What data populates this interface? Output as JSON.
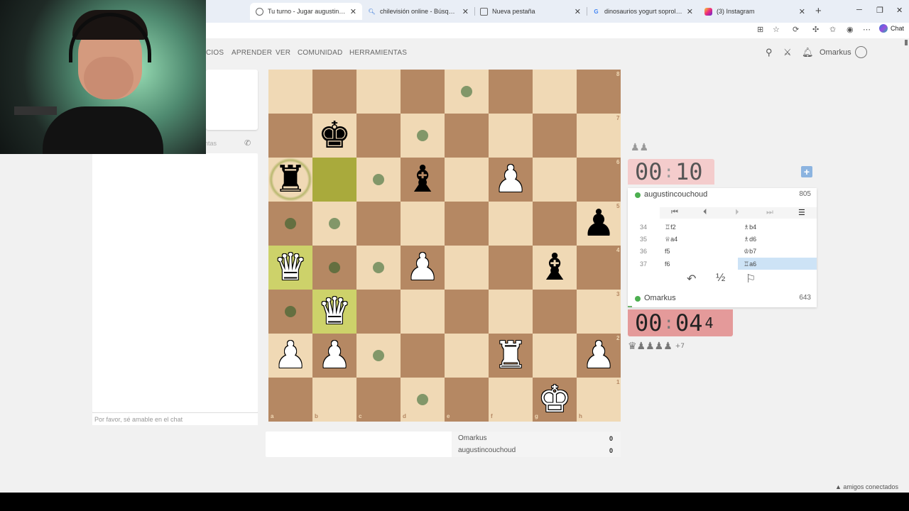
{
  "browser": {
    "tabs": [
      {
        "title": "Tu turno - Jugar augustincouchoud",
        "active": true
      },
      {
        "title": "chilevisión online - Búsqueda",
        "active": false
      },
      {
        "title": "Nueva pestaña",
        "active": false
      },
      {
        "title": "dinosaurios yogurt soprole 90s -",
        "active": false
      },
      {
        "title": "(3) Instagram",
        "active": false
      }
    ],
    "chat_button": "Chat"
  },
  "site": {
    "nav": [
      "CIOS",
      "APRENDER",
      "VER",
      "COMUNIDAD",
      "HERRAMIENTAS"
    ],
    "username": "Omarkus"
  },
  "chat": {
    "header_tail": "ntas",
    "input_placeholder": "Por favor, sé amable en el chat"
  },
  "board": {
    "files": [
      "a",
      "b",
      "c",
      "d",
      "e",
      "f",
      "g",
      "h"
    ],
    "ranks": [
      "8",
      "7",
      "6",
      "5",
      "4",
      "3",
      "2",
      "1"
    ],
    "pieces": [
      {
        "square": "b7",
        "glyph": "♚",
        "color": "black"
      },
      {
        "square": "a6",
        "glyph": "♜",
        "color": "black"
      },
      {
        "square": "d6",
        "glyph": "♝",
        "color": "black"
      },
      {
        "square": "f6",
        "glyph": "♟",
        "color": "white"
      },
      {
        "square": "h5",
        "glyph": "♟",
        "color": "black"
      },
      {
        "square": "a4",
        "glyph": "♛",
        "color": "white"
      },
      {
        "square": "d4",
        "glyph": "♟",
        "color": "white"
      },
      {
        "square": "g4",
        "glyph": "♝",
        "color": "black"
      },
      {
        "square": "b3",
        "glyph": "♛",
        "color": "white"
      },
      {
        "square": "a2",
        "glyph": "♟",
        "color": "white"
      },
      {
        "square": "b2",
        "glyph": "♟",
        "color": "white"
      },
      {
        "square": "f2",
        "glyph": "♜",
        "color": "white"
      },
      {
        "square": "h2",
        "glyph": "♟",
        "color": "white"
      },
      {
        "square": "g1",
        "glyph": "♚",
        "color": "white"
      }
    ],
    "move_dots": [
      "e8",
      "d7",
      "c6",
      "a5",
      "b5",
      "b4",
      "c4",
      "a3",
      "c2",
      "d1"
    ],
    "highlight_squares": [
      "b6"
    ],
    "lastmove_squares": [
      "a4",
      "b3"
    ],
    "check_ring_square": "a6"
  },
  "result": {
    "players": [
      {
        "name": "Omarkus",
        "score": "0"
      },
      {
        "name": "augustincouchoud",
        "score": "0"
      }
    ]
  },
  "game": {
    "opponent": {
      "name": "augustincouchoud",
      "rating": "805",
      "clock_main": "00",
      "clock_sep": ":",
      "clock_sec": "10"
    },
    "me": {
      "name": "Omarkus",
      "rating": "643",
      "clock_main": "00",
      "clock_sep": ":",
      "clock_sec": "04",
      "clock_tenths": "4"
    },
    "captured_top": "♟♟",
    "captured_bottom": "♛♟♟♟♟",
    "captured_bottom_extra": "+7",
    "moves": [
      {
        "num": "34",
        "white": "♖f2",
        "black": "♗b4"
      },
      {
        "num": "35",
        "white": "♕a4",
        "black": "♗d6"
      },
      {
        "num": "36",
        "white": "f5",
        "black": "♔b7"
      },
      {
        "num": "37",
        "white": "f6",
        "black": "♖a6"
      }
    ],
    "draw_label": "½"
  },
  "footer": {
    "friends": "▲ amigos conectados"
  }
}
